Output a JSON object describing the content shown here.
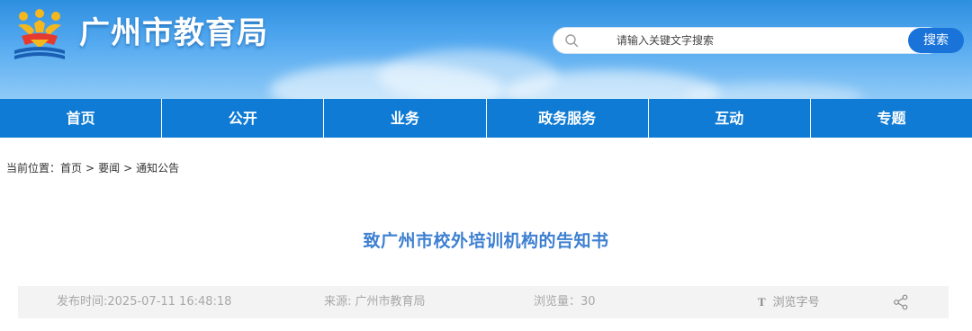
{
  "header": {
    "site_title": "广州市教育局",
    "logo_icon": "guangzhou-education-logo-icon",
    "search": {
      "placeholder": "请输入关键文字搜索",
      "button_label": "搜索",
      "icon": "search-icon"
    }
  },
  "nav": {
    "items": [
      {
        "label": "首页"
      },
      {
        "label": "公开"
      },
      {
        "label": "业务"
      },
      {
        "label": "政务服务"
      },
      {
        "label": "互动"
      },
      {
        "label": "专题"
      }
    ]
  },
  "breadcrumb": {
    "prefix": "当前位置：",
    "items": [
      "首页",
      "要闻",
      "通知公告"
    ],
    "separator": ">"
  },
  "article": {
    "title": "致广州市校外培训机构的告知书",
    "meta": {
      "publish_time": "发布时间:2025-07-11 16:48:18",
      "source_label": "来源: ",
      "source_value": "广州市教育局",
      "views": "浏览量：30",
      "font_size_icon": "T",
      "font_size_label": "浏览字号",
      "share_icon": "share-icon"
    }
  },
  "colors": {
    "nav_bg": "#0f7bd4",
    "title": "#3d7fd1",
    "search_button": "#1a73d9",
    "meta_bg": "#f3f3f3"
  }
}
